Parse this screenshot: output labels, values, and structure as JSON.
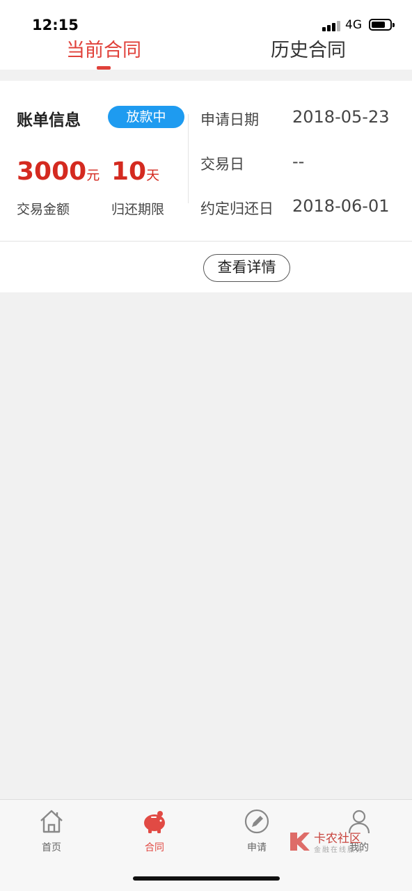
{
  "status_bar": {
    "time": "12:15",
    "network": "4G"
  },
  "tabs": [
    {
      "label": "当前合同",
      "active": true
    },
    {
      "label": "历史合同",
      "active": false
    }
  ],
  "bill": {
    "title": "账单信息",
    "status_badge": "放款中",
    "amount": "3000",
    "amount_unit": "元",
    "amount_label": "交易金额",
    "term": "10",
    "term_unit": "天",
    "term_label": "归还期限",
    "details": [
      {
        "label": "申请日期",
        "value": "2018-05-23"
      },
      {
        "label": "交易日",
        "value": "--"
      },
      {
        "label": "约定归还日",
        "value": "2018-06-01"
      }
    ],
    "detail_button": "查看详情"
  },
  "bottom_nav": [
    {
      "label": "首页",
      "icon": "home-icon",
      "active": false
    },
    {
      "label": "合同",
      "icon": "piggy-bank-icon",
      "active": true
    },
    {
      "label": "申请",
      "icon": "pencil-icon",
      "active": false
    },
    {
      "label": "我的",
      "icon": "user-icon",
      "active": false
    }
  ],
  "watermark": {
    "title": "卡农社区",
    "subtitle": "金融在线服务"
  },
  "colors": {
    "accent": "#e0413a",
    "badge": "#1e9bf0",
    "amount": "#d42a20",
    "background": "#f1f1f1"
  }
}
